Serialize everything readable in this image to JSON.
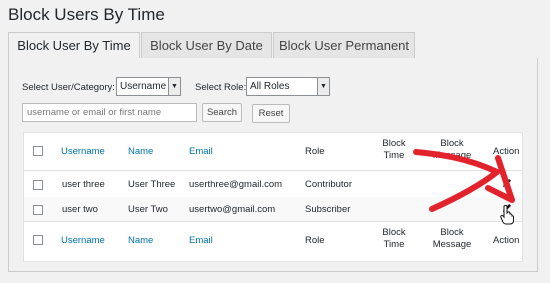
{
  "page": {
    "title": "Block Users By Time"
  },
  "tabs": [
    {
      "label": "Block User By Time",
      "active": true
    },
    {
      "label": "Block User By Date",
      "active": false
    },
    {
      "label": "Block User Permanent",
      "active": false
    }
  ],
  "filters": {
    "category_label": "Select User/Category:",
    "category_value": "Username",
    "role_label": "Select Role:",
    "role_value": "All Roles",
    "search_placeholder": "username or email or first name",
    "search_button": "Search",
    "reset_button": "Reset"
  },
  "table": {
    "columns": {
      "username": "Username",
      "name": "Name",
      "email": "Email",
      "role": "Role",
      "block_time": "Block Time",
      "block_message": "Block Message",
      "action": "Action"
    },
    "rows": [
      {
        "username": "user three",
        "name": "User Three",
        "email": "userthree@gmail.com",
        "role": "Contributor"
      },
      {
        "username": "user two",
        "name": "User Two",
        "email": "usertwo@gmail.com",
        "role": "Subscriber"
      }
    ]
  },
  "colors": {
    "link": "#0073aa",
    "annotation_arrow": "#e3232c"
  },
  "icons": [
    "pencil-edit-icon",
    "hand-pointer-cursor-icon",
    "dropdown-arrow-icon"
  ]
}
